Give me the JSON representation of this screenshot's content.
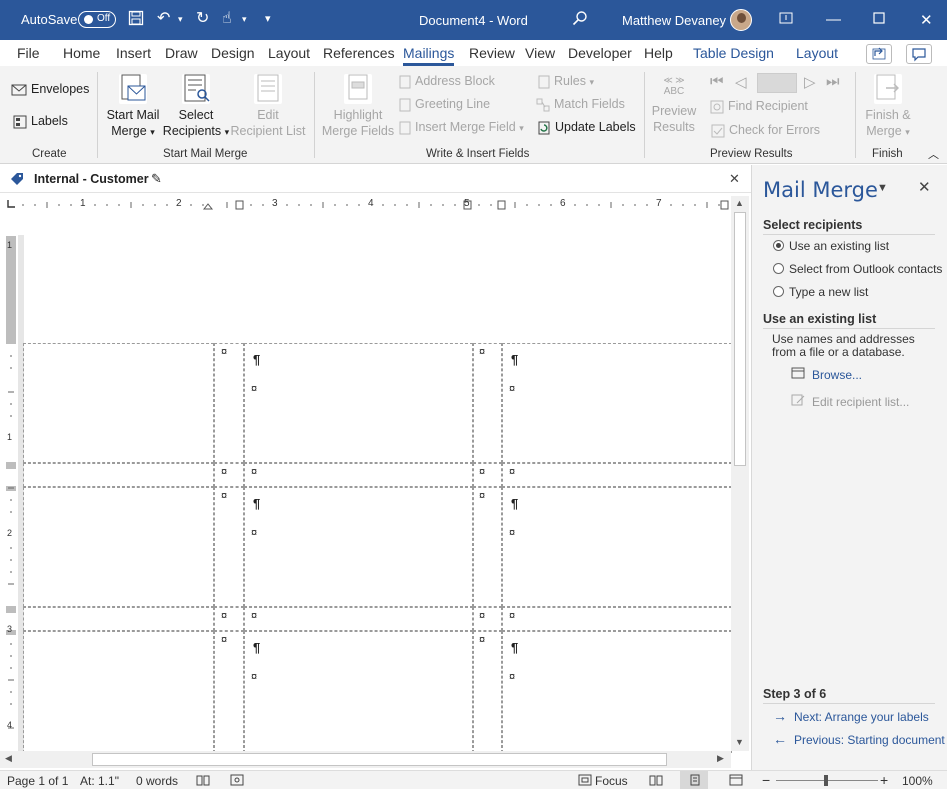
{
  "titlebar": {
    "autosave_label": "AutoSave",
    "autosave_state": "Off",
    "doc_title": "Document4 - Word",
    "user_name": "Matthew Devaney"
  },
  "tabs": [
    "File",
    "Home",
    "Insert",
    "Draw",
    "Design",
    "Layout",
    "References",
    "Mailings",
    "Review",
    "View",
    "Developer",
    "Help",
    "Table Design",
    "Layout"
  ],
  "active_tab": "Mailings",
  "ribbon": {
    "create": {
      "label": "Create",
      "envelopes": "Envelopes",
      "labels": "Labels"
    },
    "start": {
      "label": "Start Mail Merge",
      "start_line1": "Start Mail",
      "start_line2": "Merge",
      "select_line1": "Select",
      "select_line2": "Recipients",
      "edit_line1": "Edit",
      "edit_line2": "Recipient List"
    },
    "write": {
      "label": "Write & Insert Fields",
      "highlight_line1": "Highlight",
      "highlight_line2": "Merge Fields",
      "address_block": "Address Block",
      "greeting_line": "Greeting Line",
      "insert_merge_field": "Insert Merge Field",
      "rules": "Rules",
      "match_fields": "Match Fields",
      "update_labels": "Update Labels"
    },
    "preview": {
      "label": "Preview Results",
      "abc": "ABC",
      "preview_line1": "Preview",
      "preview_line2": "Results",
      "find_recipient": "Find Recipient",
      "check_errors": "Check for Errors"
    },
    "finish": {
      "label": "Finish",
      "finish_line1": "Finish &",
      "finish_line2": "Merge"
    }
  },
  "docbar": {
    "label": "Internal - Customer"
  },
  "ruler": {
    "h_numbers": [
      "1",
      "2",
      "3",
      "4",
      "5",
      "6",
      "7"
    ],
    "v_numbers": [
      "1",
      "1",
      "2",
      "3",
      "4"
    ]
  },
  "doc": {
    "pilcrow": "¶",
    "end_cell": "¤"
  },
  "pane": {
    "title": "Mail Merge",
    "section1": "Select recipients",
    "option1": "Use an existing list",
    "option2": "Select from Outlook contacts",
    "option3": "Type a new list",
    "section2": "Use an existing list",
    "desc_line1": "Use names and addresses",
    "desc_line2": "from a file or a database.",
    "browse": "Browse...",
    "edit_list": "Edit recipient list...",
    "step": "Step 3 of 6",
    "next": "Next: Arrange your labels",
    "previous": "Previous: Starting document"
  },
  "status": {
    "page": "Page 1 of 1",
    "at": "At: 1.1\"",
    "words": "0 words",
    "focus": "Focus",
    "zoom": "100%"
  }
}
